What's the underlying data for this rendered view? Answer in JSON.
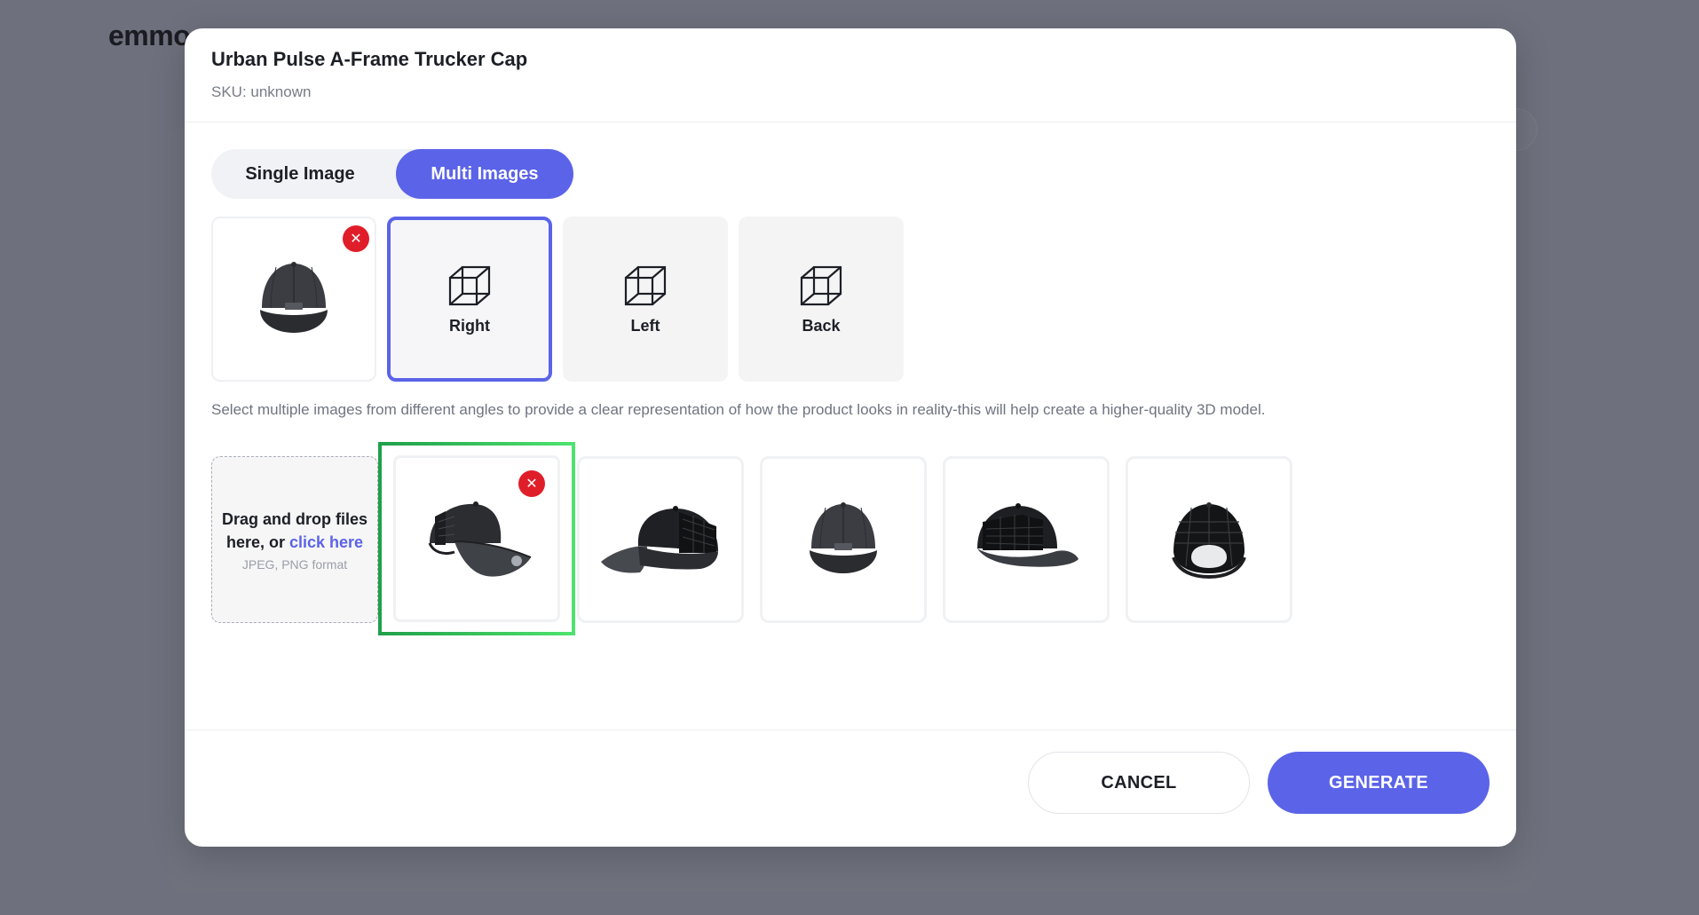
{
  "background": {
    "logo": "emmo"
  },
  "modal": {
    "title": "Urban Pulse A-Frame Trucker Cap",
    "sku": "SKU: unknown"
  },
  "mode_toggle": {
    "single_label": "Single Image",
    "multi_label": "Multi Images",
    "selected": "Multi Images"
  },
  "angle_slots": [
    {
      "label": "",
      "state": "filled",
      "icon": "cap-front-image"
    },
    {
      "label": "Right",
      "state": "active",
      "icon": "cube-icon"
    },
    {
      "label": "Left",
      "state": "empty",
      "icon": "cube-icon"
    },
    {
      "label": "Back",
      "state": "empty",
      "icon": "cube-icon"
    }
  ],
  "hint": "Select multiple images from different angles to provide a clear representation of how the product looks in reality-this will help create a higher-quality 3D model.",
  "dropzone": {
    "text_before": "Drag and drop files here, or ",
    "link": "click here",
    "format": "JPEG, PNG format"
  },
  "gallery": [
    {
      "icon": "cap-right-image",
      "selected": true
    },
    {
      "icon": "cap-left-image",
      "selected": false
    },
    {
      "icon": "cap-front-image",
      "selected": false
    },
    {
      "icon": "cap-three-quarter-back-image",
      "selected": false
    },
    {
      "icon": "cap-back-image",
      "selected": false
    }
  ],
  "footer": {
    "cancel_label": "CANCEL",
    "generate_label": "GENERATE"
  },
  "colors": {
    "accent": "#5b63e8",
    "remove": "#e01e2a",
    "selection": "#2fbf55",
    "overlay": "#6e717d"
  }
}
